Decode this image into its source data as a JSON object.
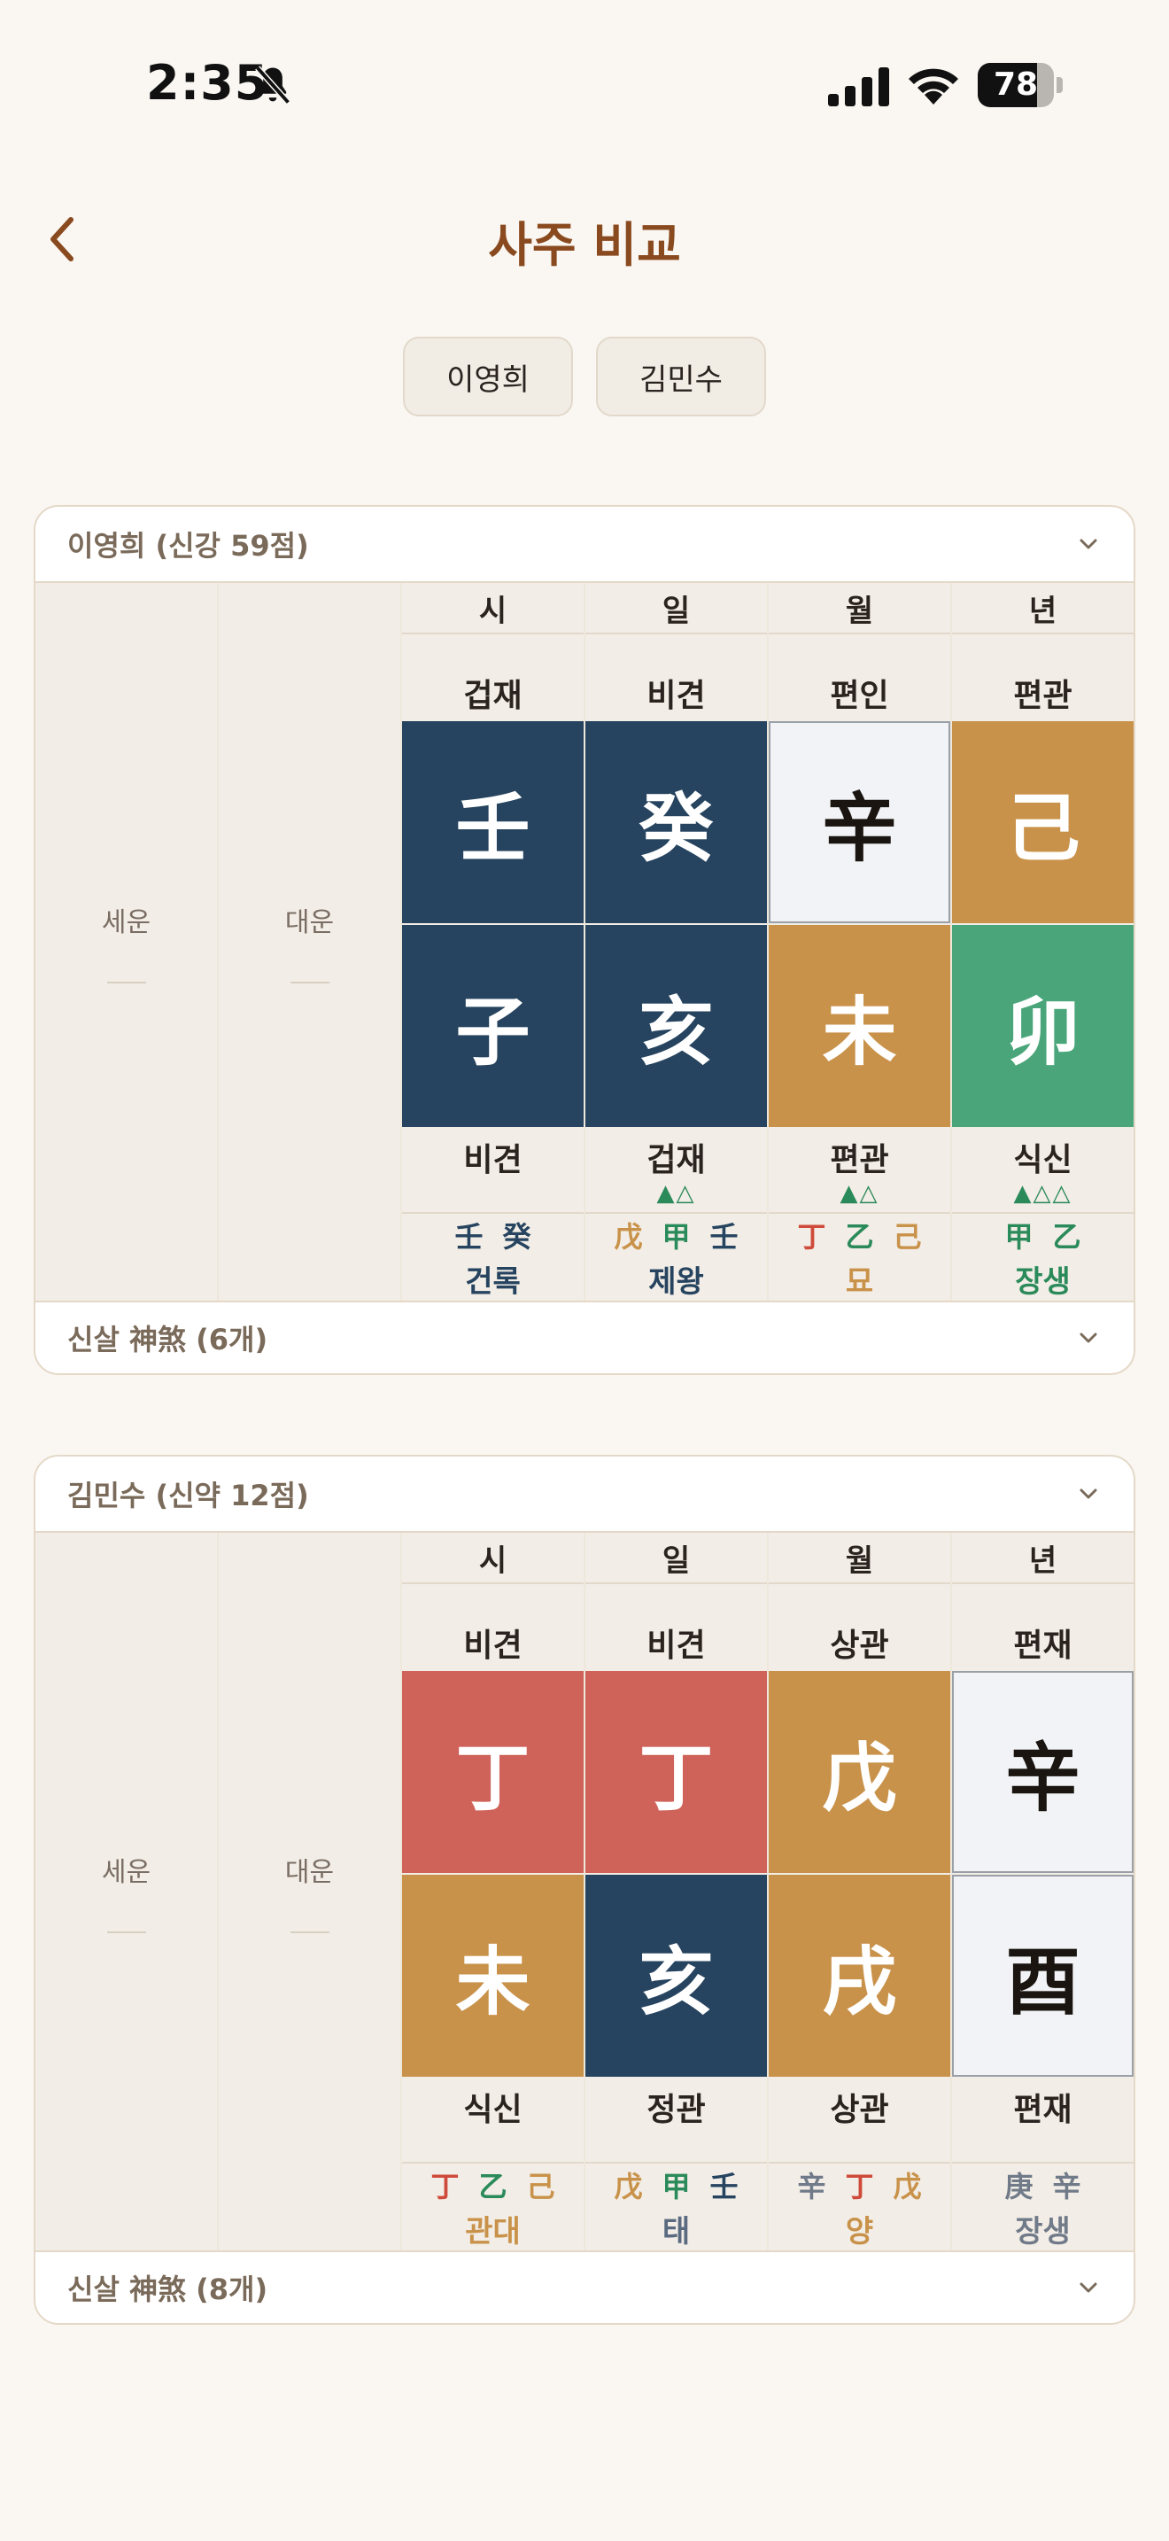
{
  "status_bar": {
    "time": "2:35",
    "battery": "78",
    "battery_level": 0.78
  },
  "header": {
    "title": "사주 비교"
  },
  "person_tabs": [
    "이영희",
    "김민수"
  ],
  "colors": {
    "water": "#26445f",
    "earth": "#c9924a",
    "wood": "#4aa67a",
    "fire": "#cf6359",
    "metal": "#f2f3f6"
  },
  "cards": [
    {
      "title": "이영희 (신강 59점)",
      "seun_label": "세운",
      "daeun_label": "대운",
      "shinsal_label": "신살 神煞 (6개)",
      "pillars": [
        {
          "head": "시",
          "top_god": "겁재",
          "stem": "壬",
          "stem_color": "#26445f",
          "stem_light": false,
          "branch": "子",
          "branch_color": "#26445f",
          "branch_light": false,
          "bottom_god": "비견",
          "marks": "",
          "hidden": [
            [
              "壬",
              "#26445f"
            ],
            [
              "癸",
              "#26445f"
            ]
          ],
          "stage": "건록",
          "stage_color": "#26445f"
        },
        {
          "head": "일",
          "top_god": "비견",
          "stem": "癸",
          "stem_color": "#26445f",
          "stem_light": false,
          "branch": "亥",
          "branch_color": "#26445f",
          "branch_light": false,
          "bottom_god": "겁재",
          "marks": "▲△",
          "hidden": [
            [
              "戊",
              "#c9924a"
            ],
            [
              "甲",
              "#2a8a5a"
            ],
            [
              "壬",
              "#26445f"
            ]
          ],
          "stage": "제왕",
          "stage_color": "#26445f"
        },
        {
          "head": "월",
          "top_god": "편인",
          "stem": "辛",
          "stem_color": "#f2f3f6",
          "stem_light": true,
          "branch": "未",
          "branch_color": "#c9924a",
          "branch_light": false,
          "bottom_god": "편관",
          "marks": "▲△",
          "hidden": [
            [
              "丁",
              "#cf4a3a"
            ],
            [
              "乙",
              "#2a8a5a"
            ],
            [
              "己",
              "#c9924a"
            ]
          ],
          "stage": "묘",
          "stage_color": "#c9924a"
        },
        {
          "head": "년",
          "top_god": "편관",
          "stem": "己",
          "stem_color": "#c9924a",
          "stem_light": false,
          "branch": "卯",
          "branch_color": "#4aa67a",
          "branch_light": false,
          "bottom_god": "식신",
          "marks": "▲△△",
          "hidden": [
            [
              "甲",
              "#2a8a5a"
            ],
            [
              "乙",
              "#2a8a5a"
            ]
          ],
          "stage": "장생",
          "stage_color": "#2a8a5a"
        }
      ]
    },
    {
      "title": "김민수 (신약 12점)",
      "seun_label": "세운",
      "daeun_label": "대운",
      "shinsal_label": "신살 神煞 (8개)",
      "pillars": [
        {
          "head": "시",
          "top_god": "비견",
          "stem": "丁",
          "stem_color": "#cf6359",
          "stem_light": false,
          "branch": "未",
          "branch_color": "#c9924a",
          "branch_light": false,
          "bottom_god": "식신",
          "marks": "",
          "hidden": [
            [
              "丁",
              "#cf4a3a"
            ],
            [
              "乙",
              "#2a8a5a"
            ],
            [
              "己",
              "#c9924a"
            ]
          ],
          "stage": "관대",
          "stage_color": "#c9924a"
        },
        {
          "head": "일",
          "top_god": "비견",
          "stem": "丁",
          "stem_color": "#cf6359",
          "stem_light": false,
          "branch": "亥",
          "branch_color": "#26445f",
          "branch_light": false,
          "bottom_god": "정관",
          "marks": "",
          "hidden": [
            [
              "戊",
              "#c9924a"
            ],
            [
              "甲",
              "#2a8a5a"
            ],
            [
              "壬",
              "#26445f"
            ]
          ],
          "stage": "태",
          "stage_color": "#5a6a80"
        },
        {
          "head": "월",
          "top_god": "상관",
          "stem": "戊",
          "stem_color": "#c9924a",
          "stem_light": false,
          "branch": "戌",
          "branch_color": "#c9924a",
          "branch_light": false,
          "bottom_god": "상관",
          "marks": "",
          "hidden": [
            [
              "辛",
              "#707a88"
            ],
            [
              "丁",
              "#cf4a3a"
            ],
            [
              "戊",
              "#c9924a"
            ]
          ],
          "stage": "양",
          "stage_color": "#c9924a"
        },
        {
          "head": "년",
          "top_god": "편재",
          "stem": "辛",
          "stem_color": "#f2f3f6",
          "stem_light": true,
          "branch": "酉",
          "branch_color": "#f2f3f6",
          "branch_light": true,
          "bottom_god": "편재",
          "marks": "",
          "hidden": [
            [
              "庚",
              "#707a88"
            ],
            [
              "辛",
              "#707a88"
            ]
          ],
          "stage": "장생",
          "stage_color": "#707a88"
        }
      ]
    }
  ]
}
